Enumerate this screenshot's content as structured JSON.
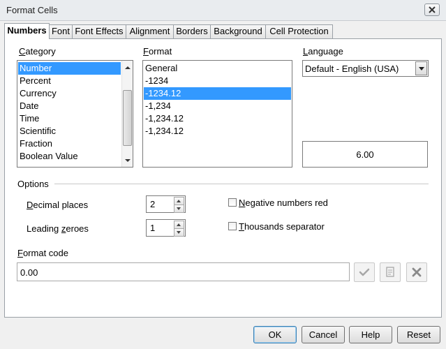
{
  "window": {
    "title": "Format Cells"
  },
  "tabs": [
    {
      "label": "Numbers",
      "active": true
    },
    {
      "label": "Font"
    },
    {
      "label": "Font Effects"
    },
    {
      "label": "Alignment"
    },
    {
      "label": "Borders"
    },
    {
      "label": "Background"
    },
    {
      "label": "Cell Protection"
    }
  ],
  "category": {
    "label": "Category",
    "items": [
      "Number",
      "Percent",
      "Currency",
      "Date",
      "Time",
      "Scientific",
      "Fraction",
      "Boolean Value"
    ],
    "selected": "Number"
  },
  "format": {
    "label": "Format",
    "items": [
      "General",
      "-1234",
      "-1234.12",
      "-1,234",
      "-1,234.12",
      "-1,234.12"
    ],
    "selected": "-1234.12"
  },
  "language": {
    "label": "Language",
    "value": "Default - English (USA)"
  },
  "preview": {
    "value": "6.00"
  },
  "options": {
    "label": "Options",
    "decimal_places": {
      "label": "Decimal places",
      "value": "2"
    },
    "leading_zeroes": {
      "label": "Leading zeroes",
      "value": "1"
    },
    "negative_red": {
      "label": "Negative numbers red",
      "checked": false
    },
    "thousands_sep": {
      "label": "Thousands separator",
      "checked": false
    }
  },
  "format_code": {
    "label": "Format code",
    "value": "0.00"
  },
  "buttons": {
    "ok": "OK",
    "cancel": "Cancel",
    "help": "Help",
    "reset": "Reset"
  },
  "icons": {
    "apply": "check-icon",
    "comment": "comment-icon",
    "delete": "delete-icon",
    "close": "close-icon"
  },
  "colors": {
    "selection": "#3399ff",
    "default_button_border": "#3c7fb1"
  }
}
